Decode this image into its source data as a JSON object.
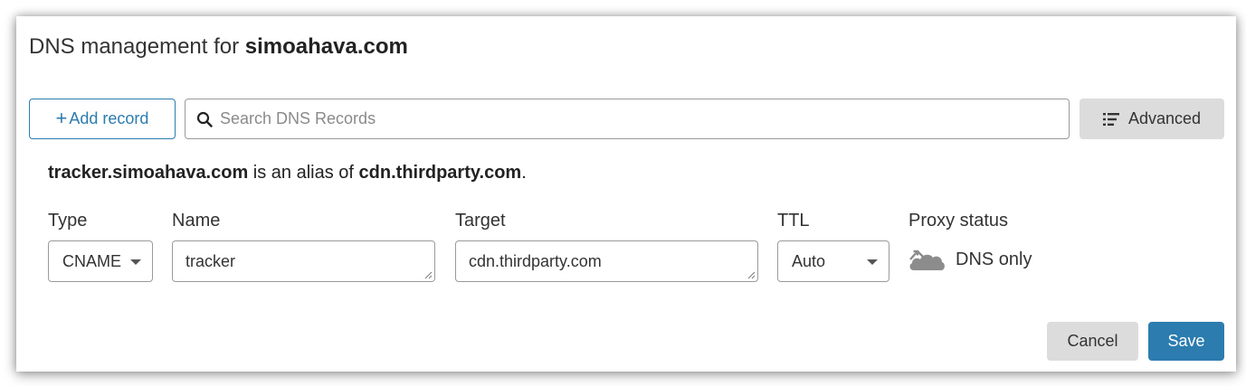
{
  "header": {
    "title_prefix": "DNS management for ",
    "domain": "simoahava.com"
  },
  "toolbar": {
    "add_record_icon": "+",
    "add_record_label": "Add record",
    "search_placeholder": "Search DNS Records",
    "search_icon": "search-icon",
    "advanced_icon": "list-icon",
    "advanced_label": "Advanced"
  },
  "alias_notice": {
    "source": "tracker.simoahava.com",
    "middle": " is an alias of ",
    "target": "cdn.thirdparty.com",
    "end": "."
  },
  "record_form": {
    "type_label": "Type",
    "type_value": "CNAME",
    "name_label": "Name",
    "name_value": "tracker",
    "target_label": "Target",
    "target_value": "cdn.thirdparty.com",
    "ttl_label": "TTL",
    "ttl_value": "Auto",
    "proxy_label": "Proxy status",
    "proxy_value": "DNS only",
    "proxy_icon": "cloud-dns-only-icon"
  },
  "actions": {
    "cancel_label": "Cancel",
    "save_label": "Save"
  },
  "colors": {
    "accent": "#2c7cb0",
    "secondary_button": "#dcdcdc",
    "border": "#9a9a9a"
  }
}
